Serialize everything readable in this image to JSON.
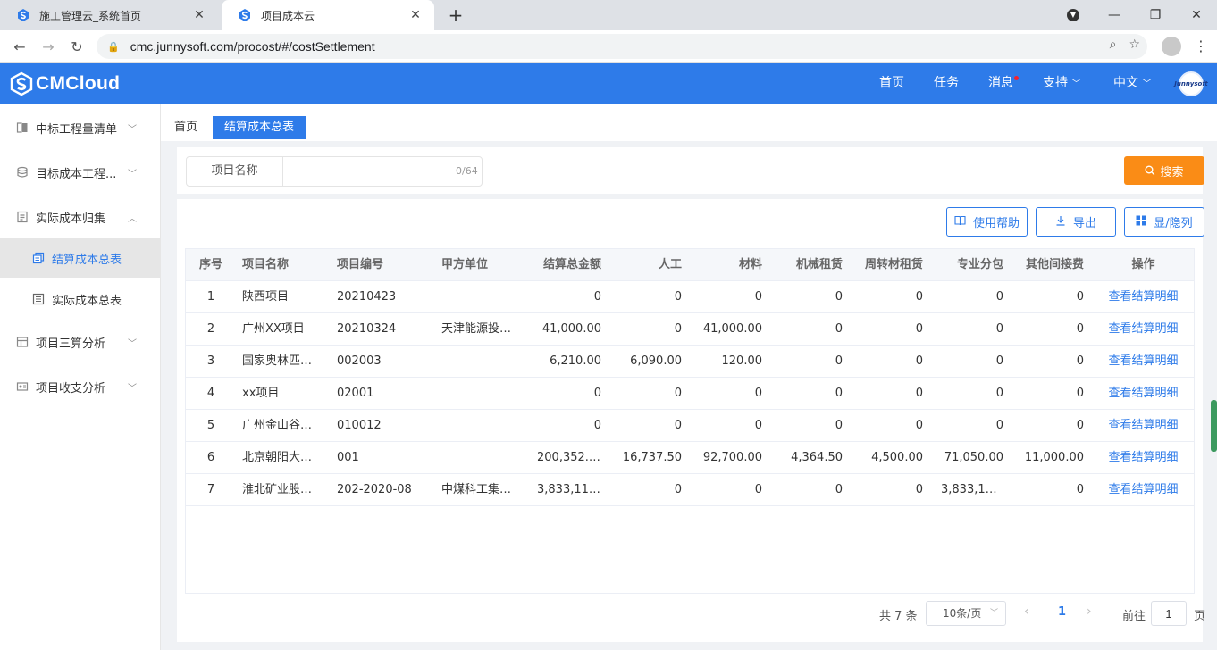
{
  "browser": {
    "tabs": [
      {
        "title": "施工管理云_系统首页"
      },
      {
        "title": "项目成本云"
      }
    ],
    "url": "cmc.junnysoft.com/procost/#/costSettlement"
  },
  "header": {
    "logo_text": "CMCloud",
    "nav": [
      "首页",
      "任务",
      "消息",
      "支持",
      "中文"
    ],
    "avatar_text": "Junnysoft"
  },
  "sidebar": {
    "items": [
      {
        "label": "中标工程量清单"
      },
      {
        "label": "目标成本工程..."
      },
      {
        "label": "实际成本归集"
      },
      {
        "label": "结算成本总表"
      },
      {
        "label": "实际成本总表"
      },
      {
        "label": "项目三算分析"
      },
      {
        "label": "项目收支分析"
      }
    ]
  },
  "breadcrumb": {
    "home": "首页",
    "current": "结算成本总表"
  },
  "search": {
    "label": "项目名称",
    "value": "",
    "counter": "0/64",
    "button": "搜索"
  },
  "actions": {
    "help": "使用帮助",
    "export": "导出",
    "columns": "显/隐列"
  },
  "table": {
    "columns": [
      "序号",
      "项目名称",
      "项目编号",
      "甲方单位",
      "结算总金额",
      "人工",
      "材料",
      "机械租赁",
      "周转材租赁",
      "专业分包",
      "其他间接费",
      "操作"
    ],
    "rows": [
      [
        "1",
        "陕西项目",
        "20210423",
        "",
        "0",
        "0",
        "0",
        "0",
        "0",
        "0",
        "0",
        "查看结算明细"
      ],
      [
        "2",
        "广州XX项目",
        "20210324",
        "天津能源投资...",
        "41,000.00",
        "0",
        "41,000.00",
        "0",
        "0",
        "0",
        "0",
        "查看结算明细"
      ],
      [
        "3",
        "国家奥林匹克...",
        "002003",
        "",
        "6,210.00",
        "6,090.00",
        "120.00",
        "0",
        "0",
        "0",
        "0",
        "查看结算明细"
      ],
      [
        "4",
        "xx项目",
        "02001",
        "",
        "0",
        "0",
        "0",
        "0",
        "0",
        "0",
        "0",
        "查看结算明细"
      ],
      [
        "5",
        "广州金山谷花...",
        "010012",
        "",
        "0",
        "0",
        "0",
        "0",
        "0",
        "0",
        "0",
        "查看结算明细"
      ],
      [
        "6",
        "北京朝阳大楼...",
        "001",
        "",
        "200,352.00",
        "16,737.50",
        "92,700.00",
        "4,364.50",
        "4,500.00",
        "71,050.00",
        "11,000.00",
        "查看结算明细"
      ],
      [
        "7",
        "淮北矿业股份...",
        "202-2020-08",
        "中煤科工集团...",
        "3,833,119....",
        "0",
        "0",
        "0",
        "0",
        "3,833,119....",
        "0",
        "查看结算明细"
      ]
    ]
  },
  "pagination": {
    "total": "共 7 条",
    "page_size": "10条/页",
    "current_page": "1",
    "goto_label": "前往",
    "goto_value": "1",
    "goto_unit": "页"
  },
  "colors": {
    "primary": "#2e7be9",
    "search_button": "#fa8c16"
  }
}
